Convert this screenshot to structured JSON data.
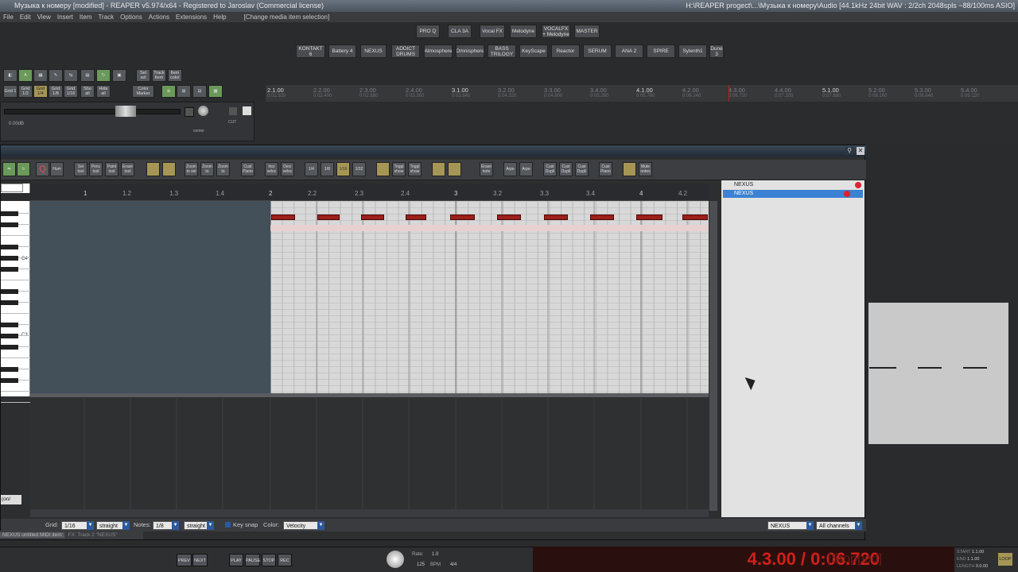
{
  "title_bar": {
    "text": "Музыка к номеру [modified] - REAPER v5.974/x64 - Registered to Jaroslav (Commercial license)",
    "right_text": "H:\\REAPER progect\\...\\Музыка к номеру\\Audio [44.1kHz 24bit WAV : 2/2ch 2048spls ~88/100ms ASIO]"
  },
  "menu": {
    "items": [
      "File",
      "Edit",
      "View",
      "Insert",
      "Item",
      "Track",
      "Options",
      "Actions",
      "Extensions",
      "Help"
    ],
    "hint": "[Change media item selection]"
  },
  "fx_row1": [
    "PRO Q",
    "CLA 3A",
    "Vocal FX",
    "Melodyne",
    "VOCALFX + Melodyne",
    "MASTER"
  ],
  "fx_row2": [
    "KONTAKT 6",
    "Battery 4",
    "NEXUS",
    "ADDICT DRUMS",
    "Atmosphere",
    "Omnisphere",
    "BASS TRILOGY",
    "KeyScape",
    "Reactor",
    "SERUM",
    "ANA 2",
    "SPIRE",
    "Sylenth1",
    "Dune 3"
  ],
  "main_toolbar": [
    "Grid 1",
    "Grid 1/2",
    "Grid 1/4",
    "Grid 1/8",
    "Grid 1/16",
    "Sho all",
    "Hide all",
    "Color Marker",
    "Sel sel",
    "Track Item",
    "Item color"
  ],
  "track_panel": {
    "volume": "0.00dB",
    "pan": "center",
    "mode": "CUT"
  },
  "arrange_ruler": [
    {
      "bar": "2.1.00",
      "time": "0:01.920"
    },
    {
      "bar": "2.2.00",
      "time": "0:02.400"
    },
    {
      "bar": "2.3.00",
      "time": "0:02.880"
    },
    {
      "bar": "2.4.00",
      "time": "0:03.360"
    },
    {
      "bar": "3.1.00",
      "time": "0:03.840"
    },
    {
      "bar": "3.2.00",
      "time": "0:04.320"
    },
    {
      "bar": "3.3.00",
      "time": "0:04.800"
    },
    {
      "bar": "3.4.00",
      "time": "0:05.280"
    },
    {
      "bar": "4.1.00",
      "time": "0:05.760"
    },
    {
      "bar": "4.2.00",
      "time": "0:06.240"
    },
    {
      "bar": "4.3.00",
      "time": "0:06.720"
    },
    {
      "bar": "4.4.00",
      "time": "0:07.200"
    },
    {
      "bar": "5.1.00",
      "time": "0:07.680"
    },
    {
      "bar": "5.2.00",
      "time": "0:08.160"
    },
    {
      "bar": "5.3.00",
      "time": "0:08.640"
    },
    {
      "bar": "5.4.00",
      "time": "0:09.120"
    }
  ],
  "midi_toolbar": [
    "Hum",
    "Sel tool",
    "Penc tool",
    "Paint tool",
    "Erase tool",
    "Zoom to sel",
    "Zoom to",
    "Zoom to",
    "Cust Piano",
    "Incr veloc",
    "Decr veloc",
    "1/4",
    "1/8",
    "1/16",
    "1/32",
    "Toggl show",
    "Toggl show",
    "Erase note",
    "Arpe",
    "Arpe",
    "Cust Dupli",
    "Cust Dupli",
    "Cust Dupli",
    "Cust Piano",
    "Mute notes"
  ],
  "midi_ruler": [
    "1",
    "1.2",
    "1.3",
    "1.4",
    "2",
    "2.2",
    "2.3",
    "2.4",
    "3",
    "3.2",
    "3.3",
    "3.4",
    "4",
    "4.2"
  ],
  "piano_labels": {
    "c4": "C4",
    "c3": "C3"
  },
  "midi_tracks": [
    "NEXUS",
    "NEXUS"
  ],
  "midi_status": {
    "grid_label": "Grid:",
    "grid_value": "1/16",
    "grid_mode": "straight",
    "notes_label": "Notes:",
    "notes_value": "1/8",
    "notes_mode": "straight",
    "keysnap": "Key snap",
    "color_label": "Color:",
    "color_value": "Velocity",
    "track_value": "NEXUS",
    "channels_value": "All channels",
    "cc_lane": "(on/"
  },
  "tabs": [
    "NEXUS untitled MIDI item",
    "FX: Track 2 \"NEXUS\""
  ],
  "transport": {
    "prev": "PREV",
    "next": "NEXT",
    "play": "PLAY",
    "pause": "PAUSE",
    "stop": "STOP",
    "rec": "REC",
    "rate_label": "Rate:",
    "rate_value": "1.0",
    "bpm_value": "125",
    "bpm_label": "BPM",
    "timesig": "4/4",
    "position": "4.3.00 / 0:06.720",
    "state": "[Stopped]",
    "start_label": "START",
    "end_label": "END",
    "length_label": "LENGTH",
    "start_value": "1.1.00",
    "end_value": "1.1.00",
    "length_value": "0.0.00",
    "loop": "LOOP"
  },
  "chart_data": null
}
